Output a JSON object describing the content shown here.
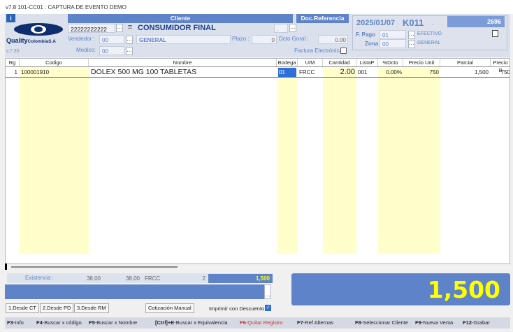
{
  "window": {
    "title": "v7.8 101-CC01 : CAPTURA DE EVENTO DEMO"
  },
  "header": {
    "info_icon": "info-icon",
    "version": "v.7.35",
    "logo": {
      "brand": "Quality",
      "suffix": "ColombiaS.A"
    },
    "cliente_label": "Cliente",
    "cliente_code": "22222222222",
    "cliente_name": "CONSUMIDOR FINAL",
    "vendedor_label": "Vendedor :",
    "vendedor_code": "00",
    "vendedor_name": "GENERAL",
    "medico_label": "Medico:",
    "medico_code": "00",
    "plazo_label": "Plazo :",
    "plazo_value": "0",
    "dcto_label": "Dcto Gnral :",
    "dcto_value": "0.00",
    "docref_label": "Doc.Referencia",
    "docref_value": ".",
    "factura_label": "Factura Electrónica",
    "date": "2025/01/07",
    "doc_code": "K011",
    "doc_dot": ".",
    "doc_number": "2696",
    "fpago_label": "F. Pago",
    "fpago_code": "01",
    "fpago_name": "EFECTIVO",
    "zona_label": "Zona",
    "zona_code": "00",
    "zona_name": "GENERAL"
  },
  "grid": {
    "columns": [
      "Rg",
      "Codigo",
      "Nombre",
      "Bodega",
      "U/M",
      "Cantidad",
      "ListaP",
      "%Dcto",
      "Precio Unit",
      "Parcial",
      "Precio B"
    ],
    "rows": [
      {
        "rg": "1",
        "codigo": "100001910",
        "nombre": "DOLEX 500 MG 100 TABLETAS",
        "bodega": "01",
        "um": "FRCC",
        "cantidad": "2.00",
        "listap": "001",
        "dcto": "0.00%",
        "precio_unit": "750",
        "parcial": "1,500",
        "precio_b": "750"
      }
    ]
  },
  "summary": {
    "existencia_label": "Existencia :",
    "exist1": "38.00",
    "exist2": "38.00",
    "exist_um": "FRCC",
    "exist_count": "2",
    "exist_total": "1,500",
    "total": "1,500"
  },
  "buttons": {
    "desde_ct": "1.Desde CT",
    "desde_pd": "2.Desde PD",
    "desde_rm": "3.Desde RM",
    "cotizacion": "Cotización Manual",
    "imprimir": "Imprimir con Descuento"
  },
  "footer": {
    "keys": [
      {
        "key": "F3",
        "text": "-Info"
      },
      {
        "key": "F4",
        "text": "-Buscar x código"
      },
      {
        "key": "F5",
        "text": "-Buscar x Nombre"
      },
      {
        "key": "[Ctrl]+E",
        "text": "-Buscar x Equivalencia"
      },
      {
        "key": "F6",
        "text": "-Quitar Registro"
      },
      {
        "key": "F7",
        "text": "-Ref Alternas"
      },
      {
        "key": "F8",
        "text": "-Seleccionar Cliente"
      },
      {
        "key": "F9",
        "text": "-Nueva Venta"
      },
      {
        "key": "F12",
        "text": "-Grabar"
      }
    ]
  },
  "colors": {
    "accent": "#5e83c9",
    "total_text": "#ffff00",
    "yellow_col": "#ffffcc",
    "f6_red": "#c0392b"
  }
}
